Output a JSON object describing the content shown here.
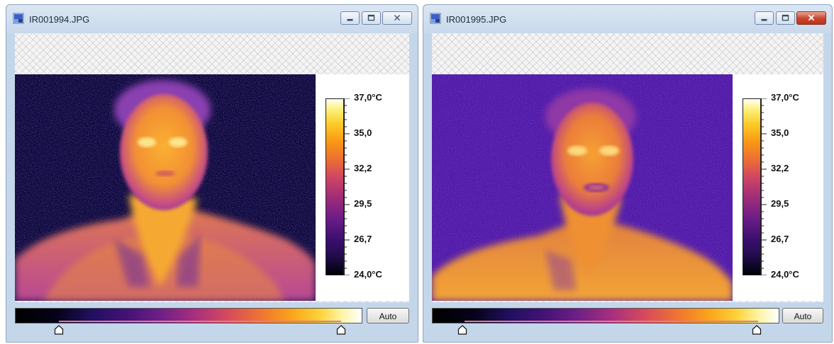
{
  "windows": [
    {
      "title": "IR001994.JPG",
      "scale": {
        "max_label": "37,0°C",
        "labels": [
          "35,0",
          "32,2",
          "29,5",
          "26,7"
        ],
        "min_label": "24,0°C"
      },
      "palette": {
        "auto_label": "Auto",
        "range_low": 0.12,
        "range_high": 0.925
      },
      "background": "dark"
    },
    {
      "title": "IR001995.JPG",
      "scale": {
        "max_label": "37,0°C",
        "labels": [
          "35,0",
          "32,2",
          "29,5",
          "26,7"
        ],
        "min_label": "24,0°C"
      },
      "palette": {
        "auto_label": "Auto",
        "range_low": 0.09,
        "range_high": 0.925
      },
      "background": "violet"
    }
  ],
  "colors": {
    "titlebar": "#c8d9ec",
    "window_frame": "#c4d6ea",
    "close_active": "#c9442a"
  },
  "icons": {
    "app": "ir-image-icon",
    "minimize": "minimize-icon",
    "maximize": "maximize-icon",
    "close": "close-icon",
    "slider_handle": "slider-handle-icon"
  }
}
